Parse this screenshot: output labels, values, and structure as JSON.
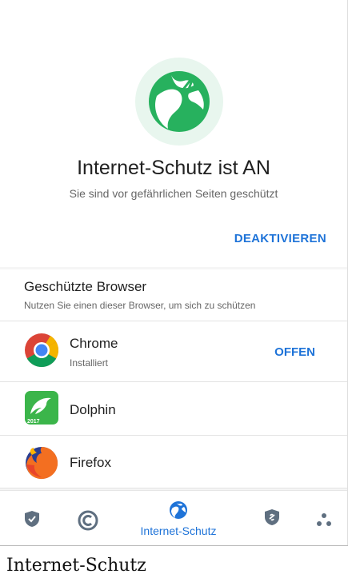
{
  "hero": {
    "title": "Internet-Schutz ist AN",
    "subtitle": "Sie sind vor gefährlichen Seiten geschützt",
    "deactivate_label": "DEAKTIVIEREN",
    "icon": "protected-globe-icon"
  },
  "browsers": {
    "title": "Geschützte Browser",
    "subtitle": "Nutzen Sie einen dieser Browser, um sich zu schützen",
    "items": [
      {
        "name": "Chrome",
        "status": "Installiert",
        "action": "OFFEN",
        "icon": "chrome-icon"
      },
      {
        "name": "Dolphin",
        "status": "",
        "action": "",
        "icon": "dolphin-icon"
      },
      {
        "name": "Firefox",
        "status": "",
        "action": "",
        "icon": "firefox-icon"
      }
    ]
  },
  "bottom_nav": {
    "active_label": "Internet-Schutz",
    "items": [
      "shield-check-icon",
      "copyright-scan-icon",
      "internet-protection-icon",
      "shield-link-icon",
      "more-dots-icon"
    ]
  },
  "caption": "Internet-Schutz",
  "colors": {
    "accent": "#1e73d8",
    "brand_green": "#27b15e",
    "hero_circle": "#e8f6ee"
  }
}
